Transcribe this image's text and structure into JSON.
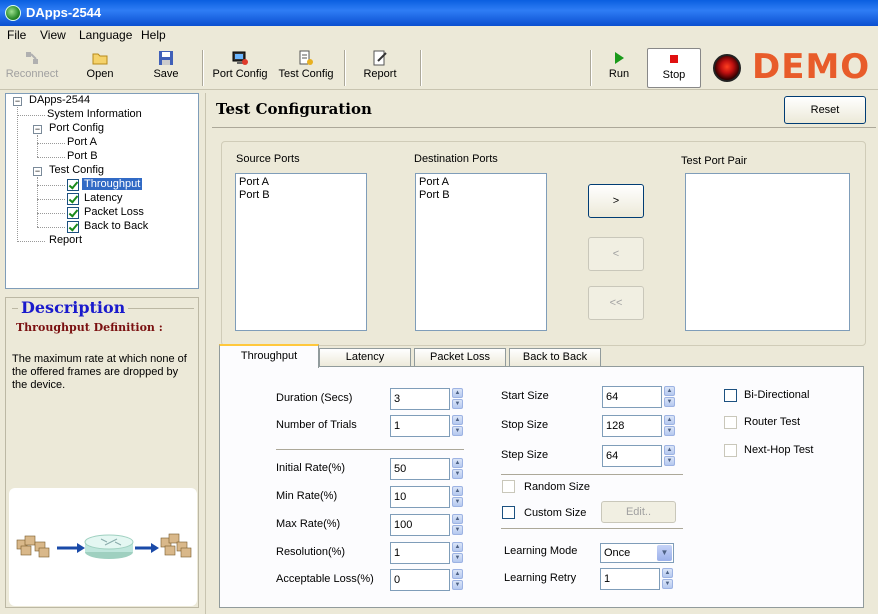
{
  "window": {
    "title": "DApps-2544"
  },
  "menu": [
    "File",
    "View",
    "Language",
    "Help"
  ],
  "toolbar": {
    "reconnect": "Reconnect",
    "open": "Open",
    "save": "Save",
    "port_config": "Port Config",
    "test_config": "Test Config",
    "report": "Report",
    "run": "Run",
    "stop": "Stop",
    "brand": "DEMO"
  },
  "tree": {
    "root": "DApps-2544",
    "system_information": "System Information",
    "port_config": "Port Config",
    "port_a": "Port A",
    "port_b": "Port B",
    "test_config": "Test Config",
    "throughput": "Throughput",
    "latency": "Latency",
    "packet_loss": "Packet Loss",
    "back_to_back": "Back to Back",
    "report": "Report"
  },
  "description": {
    "title": "Description",
    "subtitle": "Throughput Definition :",
    "body": "The maximum rate at which none of the offered frames are dropped by the device."
  },
  "config": {
    "title": "Test Configuration",
    "reset": "Reset",
    "source_ports_label": "Source Ports",
    "source_ports": [
      "Port A",
      "Port B"
    ],
    "destination_ports_label": "Destination Ports",
    "destination_ports": [
      "Port A",
      "Port B"
    ],
    "test_port_pair_label": "Test Port Pair",
    "move_right": ">",
    "move_left": "<",
    "move_all_left": "<<"
  },
  "tabs": [
    "Throughput",
    "Latency",
    "Packet Loss",
    "Back to Back"
  ],
  "throughput": {
    "duration_label": "Duration (Secs)",
    "duration": "3",
    "trials_label": "Number of Trials",
    "trials": "1",
    "initial_rate_label": "Initial Rate(%)",
    "initial_rate": "50",
    "min_rate_label": "Min Rate(%)",
    "min_rate": "10",
    "max_rate_label": "Max Rate(%)",
    "max_rate": "100",
    "resolution_label": "Resolution(%)",
    "resolution": "1",
    "acceptable_loss_label": "Acceptable Loss(%)",
    "acceptable_loss": "0",
    "start_size_label": "Start Size",
    "start_size": "64",
    "stop_size_label": "Stop Size",
    "stop_size": "128",
    "step_size_label": "Step Size",
    "step_size": "64",
    "random_size_label": "Random Size",
    "custom_size_label": "Custom Size",
    "edit_label": "Edit..",
    "learning_mode_label": "Learning Mode",
    "learning_mode": "Once",
    "learning_retry_label": "Learning Retry",
    "learning_retry": "1",
    "bidirectional_label": "Bi-Directional",
    "router_test_label": "Router Test",
    "nexthop_test_label": "Next-Hop Test"
  }
}
